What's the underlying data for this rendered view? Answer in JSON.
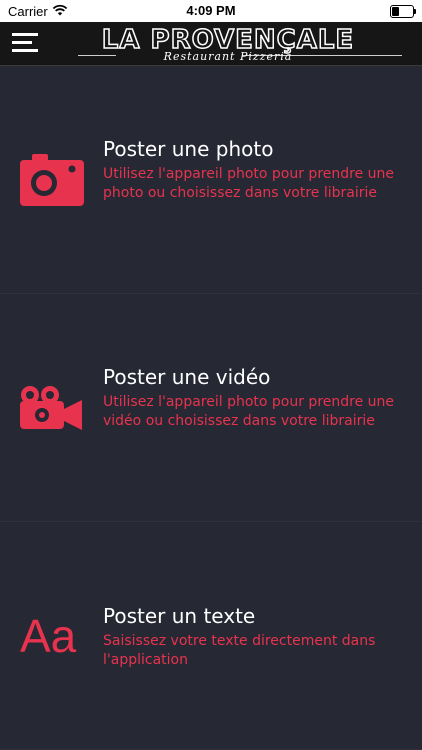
{
  "status_bar": {
    "carrier": "Carrier",
    "time": "4:09 PM"
  },
  "header": {
    "logo_title": "LA PROVENÇALE",
    "logo_subtitle": "Restaurant Pizzeria"
  },
  "options": [
    {
      "icon": "camera-icon",
      "title": "Poster une photo",
      "description": "Utilisez l'appareil photo pour prendre une photo ou choisissez dans votre librairie"
    },
    {
      "icon": "video-camera-icon",
      "title": "Poster une vidéo",
      "description": "Utilisez l'appareil photo pour prendre une vidéo ou choisissez dans votre librairie"
    },
    {
      "icon": "text-icon",
      "icon_text": "Aa",
      "title": "Poster un texte",
      "description": "Saisissez votre texte directement dans l'application"
    }
  ],
  "colors": {
    "accent": "#e8334f",
    "background": "#262833",
    "header": "#161616"
  }
}
